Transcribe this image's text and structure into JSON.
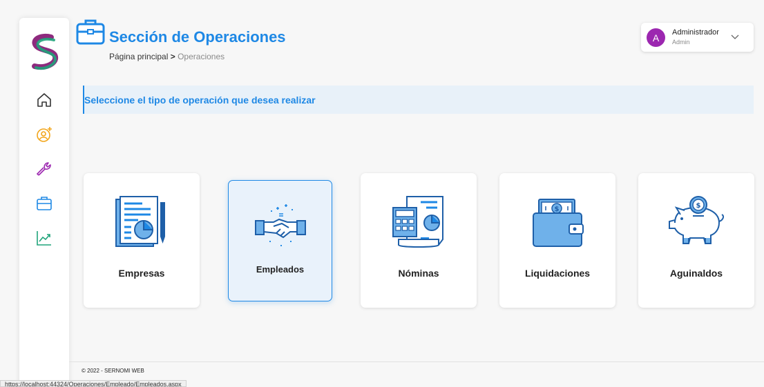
{
  "header": {
    "title": "Sección de Operaciones",
    "breadcrumb": {
      "home": "Página principal",
      "separator": ">",
      "current": "Operaciones"
    }
  },
  "user": {
    "initial": "A",
    "name": "Administrador",
    "role": "Admin",
    "avatar_color": "#9c27b0"
  },
  "sidebar": {
    "items": [
      {
        "icon": "home-icon"
      },
      {
        "icon": "user-add-icon"
      },
      {
        "icon": "wrench-icon"
      },
      {
        "icon": "briefcase-icon"
      },
      {
        "icon": "chart-line-icon"
      }
    ]
  },
  "banner": {
    "text": "Seleccione el tipo de operación que desea realizar"
  },
  "cards": [
    {
      "label": "Empresas",
      "icon": "document-chart-icon",
      "selected": false
    },
    {
      "label": "Empleados",
      "icon": "handshake-icon",
      "selected": true
    },
    {
      "label": "Nóminas",
      "icon": "calculator-report-icon",
      "selected": false
    },
    {
      "label": "Liquidaciones",
      "icon": "wallet-icon",
      "selected": false
    },
    {
      "label": "Aguinaldos",
      "icon": "piggy-bank-icon",
      "selected": false
    }
  ],
  "footer": {
    "text": "© 2022 - SERNOMI WEB"
  },
  "status_bar": {
    "url": "https://localhost:44324/Operaciones/Empleado/Empleados.aspx"
  },
  "colors": {
    "accent": "#1e88e5",
    "icon_green": "#1fa37a",
    "icon_orange": "#f2a51a",
    "icon_purple": "#9c27b0",
    "banner_bg": "#e8f1f9",
    "icon_light_blue": "#6fb1ea"
  }
}
